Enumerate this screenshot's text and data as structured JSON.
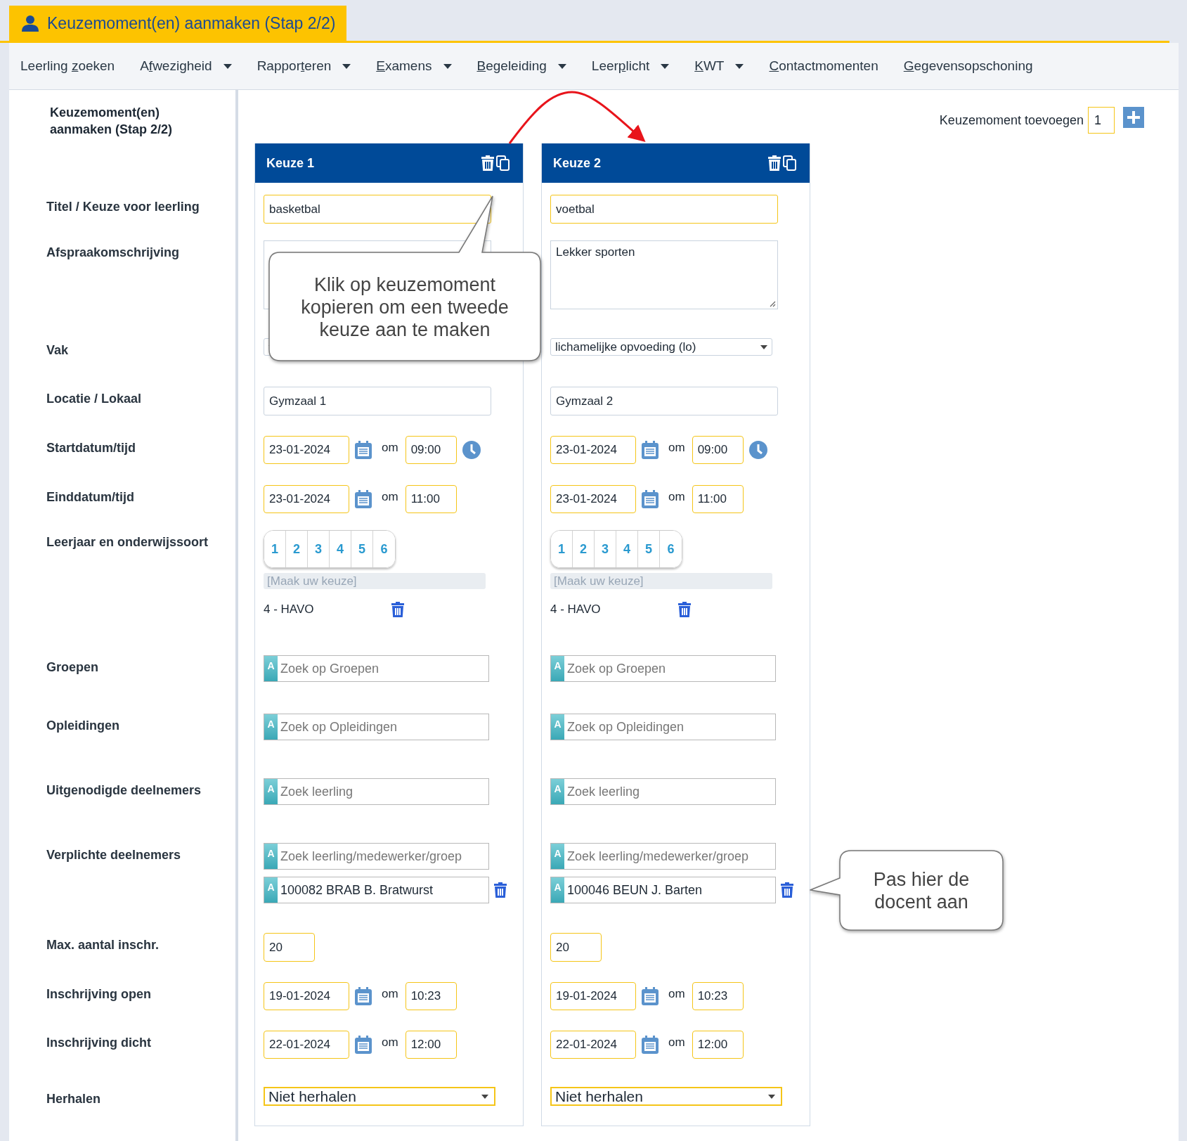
{
  "page_tab": {
    "title": "Keuzemoment(en) aanmaken (Stap 2/2)"
  },
  "nav": [
    {
      "pre": "Leerling ",
      "key": "z",
      "post": "oeken",
      "dropdown": false
    },
    {
      "pre": "A",
      "key": "f",
      "post": "wezigheid",
      "dropdown": true
    },
    {
      "pre": "Rappor",
      "key": "t",
      "post": "eren",
      "dropdown": true
    },
    {
      "key": "E",
      "post": "xamens",
      "dropdown": true
    },
    {
      "key": "B",
      "post": "egeleiding",
      "dropdown": true
    },
    {
      "pre": "Leer",
      "key": "p",
      "post": "licht",
      "dropdown": true
    },
    {
      "key": "K",
      "post": "WT",
      "dropdown": true
    },
    {
      "key": "C",
      "post": "ontactmomenten",
      "dropdown": false
    },
    {
      "key": "G",
      "post": "egevensopschoning",
      "dropdown": false
    }
  ],
  "sidebar": {
    "title": "Keuzemoment(en) aanmaken (Stap 2/2)",
    "labels": [
      "Titel / Keuze voor leerling",
      "Afspraakomschrijving",
      "Vak",
      "Locatie / Lokaal",
      "Startdatum/tijd",
      "Einddatum/tijd",
      "Leerjaar en onderwijssoort",
      "Groepen",
      "Opleidingen",
      "Uitgenodigde deelnemers",
      "Verplichte deelnemers",
      "Max. aantal inschr.",
      "Inschrijving open",
      "Inschrijving dicht",
      "Herhalen"
    ]
  },
  "add": {
    "label": "Keuzemoment toevoegen",
    "value": "1"
  },
  "choices": [
    {
      "header": "Keuze 1",
      "rows": [
        {
          "kind": "text",
          "value": "basketbal",
          "required": true
        },
        {
          "kind": "textarea"
        },
        {
          "kind": "select"
        },
        {
          "kind": "text",
          "value": "Gymzaal 1",
          "required": false
        },
        {
          "kind": "datetime",
          "date": "23-01-2024",
          "connector": "om",
          "time": "09:00",
          "clock": true
        },
        {
          "kind": "datetime",
          "date": "23-01-2024",
          "connector": "om",
          "time": "11:00",
          "clock": false
        },
        {
          "kind": "years",
          "years": [
            "1",
            "2",
            "3",
            "4",
            "5",
            "6"
          ],
          "placeholder": "[Maak uw keuze]",
          "items": [
            "4 - HAVO"
          ]
        },
        {
          "kind": "search",
          "badge": "A",
          "placeholder": "Zoek op Groepen"
        },
        {
          "kind": "search",
          "badge": "A",
          "placeholder": "Zoek op Opleidingen"
        },
        {
          "kind": "search",
          "badge": "A",
          "placeholder": "Zoek leerling"
        },
        {
          "kind": "search",
          "badge": "A",
          "placeholder": "Zoek leerling/medewerker/groep",
          "items": [
            {
              "badge": "A",
              "value": "100082 BRAB B. Bratwurst"
            }
          ]
        },
        {
          "kind": "number",
          "value": "20"
        },
        {
          "kind": "datetime",
          "date": "19-01-2024",
          "connector": "om",
          "time": "10:23",
          "clock": false
        },
        {
          "kind": "datetime",
          "date": "22-01-2024",
          "connector": "om",
          "time": "12:00",
          "clock": false
        },
        {
          "kind": "combo",
          "value": "Niet herhalen"
        }
      ]
    },
    {
      "header": "Keuze 2",
      "rows": [
        {
          "kind": "text",
          "value": "voetbal",
          "required": true
        },
        {
          "kind": "textarea",
          "value": "Lekker sporten"
        },
        {
          "kind": "select",
          "value": "lichamelijke opvoeding (lo)"
        },
        {
          "kind": "text",
          "value": "Gymzaal 2",
          "required": false
        },
        {
          "kind": "datetime",
          "date": "23-01-2024",
          "connector": "om",
          "time": "09:00",
          "clock": true
        },
        {
          "kind": "datetime",
          "date": "23-01-2024",
          "connector": "om",
          "time": "11:00",
          "clock": false
        },
        {
          "kind": "years",
          "years": [
            "1",
            "2",
            "3",
            "4",
            "5",
            "6"
          ],
          "placeholder": "[Maak uw keuze]",
          "items": [
            "4 - HAVO"
          ]
        },
        {
          "kind": "search",
          "badge": "A",
          "placeholder": "Zoek op Groepen"
        },
        {
          "kind": "search",
          "badge": "A",
          "placeholder": "Zoek op Opleidingen"
        },
        {
          "kind": "search",
          "badge": "A",
          "placeholder": "Zoek leerling"
        },
        {
          "kind": "search",
          "badge": "A",
          "placeholder": "Zoek leerling/medewerker/groep",
          "items": [
            {
              "badge": "A",
              "value": "100046 BEUN J. Barten"
            }
          ]
        },
        {
          "kind": "number",
          "value": "20"
        },
        {
          "kind": "datetime",
          "date": "19-01-2024",
          "connector": "om",
          "time": "10:23",
          "clock": false
        },
        {
          "kind": "datetime",
          "date": "22-01-2024",
          "connector": "om",
          "time": "12:00",
          "clock": false
        },
        {
          "kind": "combo",
          "value": "Niet herhalen"
        }
      ]
    }
  ],
  "callouts": [
    {
      "text": "Klik op keuzemoment kopieren om een tweede keuze aan te maken"
    },
    {
      "text": "Pas hier de docent aan"
    }
  ]
}
